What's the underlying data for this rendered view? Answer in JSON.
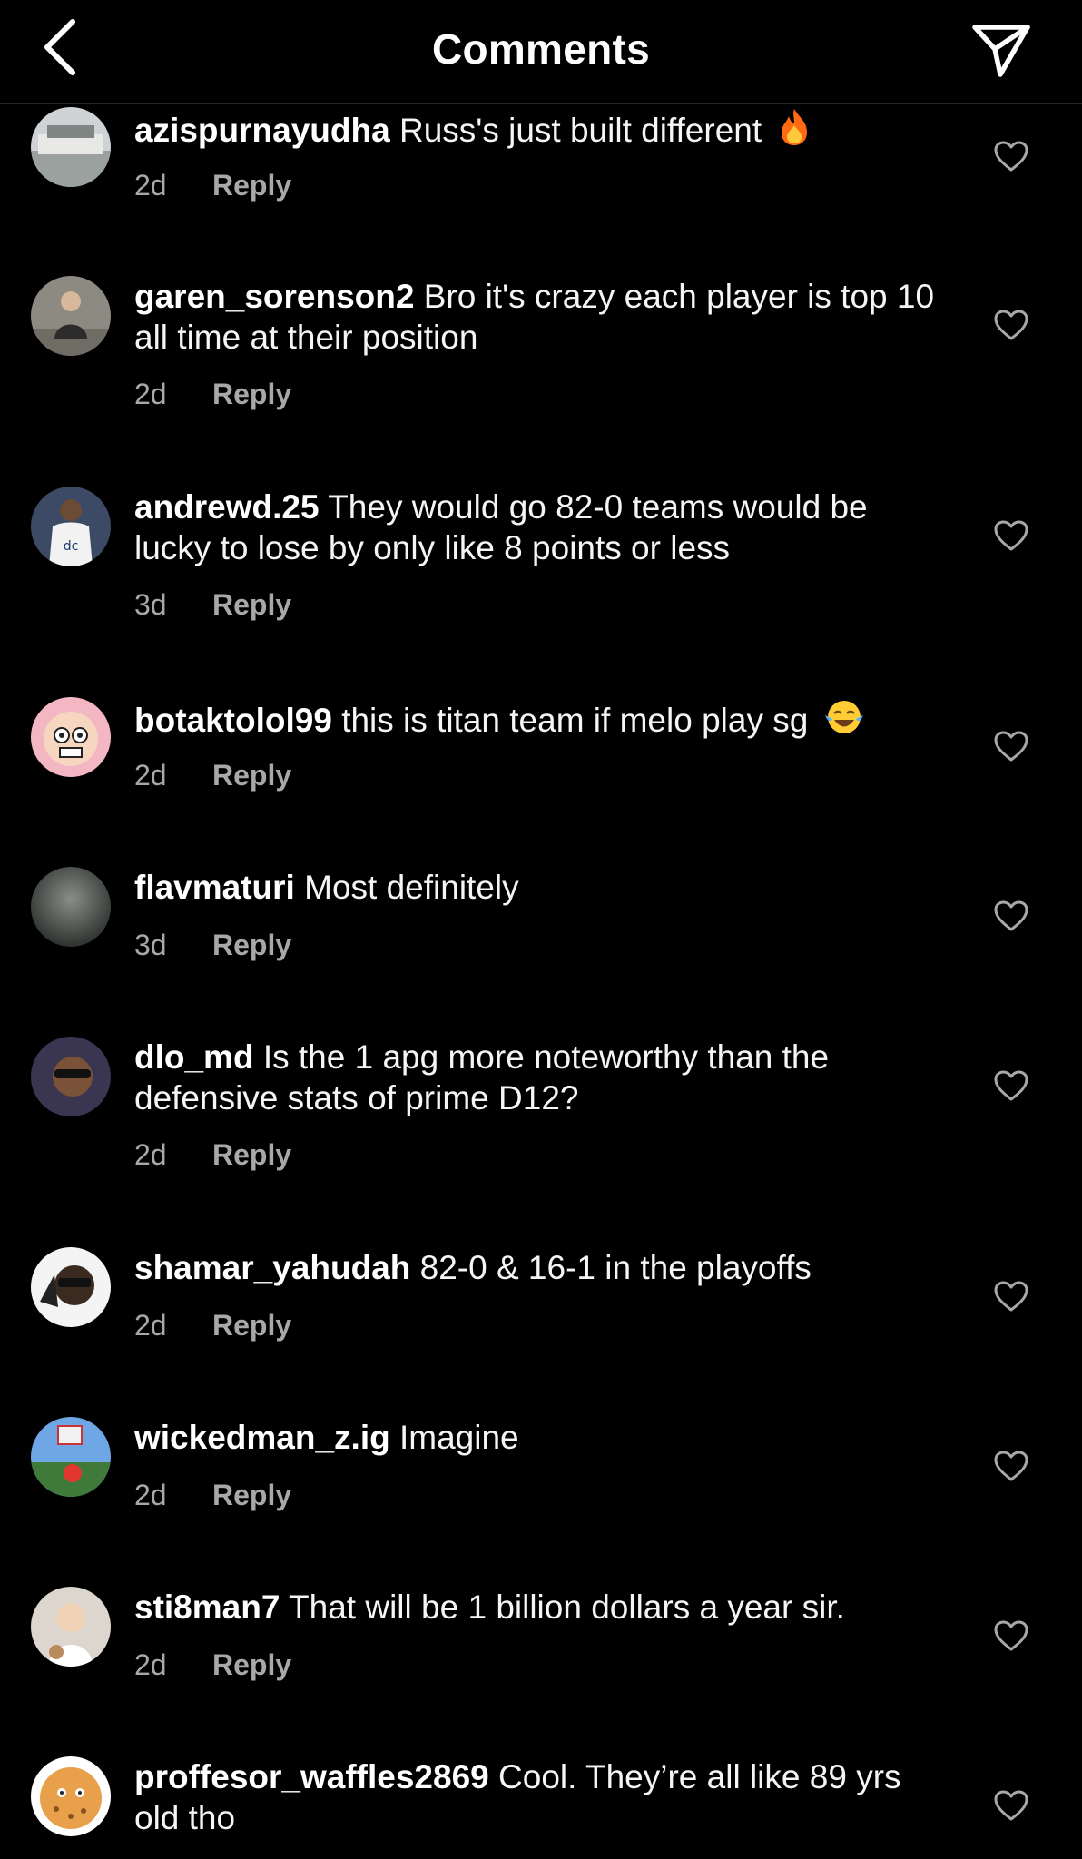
{
  "header": {
    "title": "Comments",
    "back_icon": "chevron-left-icon",
    "share_icon": "paper-plane-icon"
  },
  "colors": {
    "background": "#000000",
    "primary_text": "#ffffff",
    "secondary_text": "#a8a8a8"
  },
  "comments": [
    {
      "username": "azispurnayudha",
      "text": "Russ's just built different",
      "emoji": "fire",
      "time": "2d",
      "reply": "Reply"
    },
    {
      "username": "garen_sorenson2",
      "text": "Bro it's crazy each player is top 10 all time at their position",
      "time": "2d",
      "reply": "Reply"
    },
    {
      "username": "andrewd.25",
      "text": "They would go 82-0 teams would be lucky to lose by only like 8 points or less",
      "time": "3d",
      "reply": "Reply"
    },
    {
      "username": "botaktolol99",
      "text": "this is titan team if melo play sg",
      "emoji": "tears-of-joy",
      "time": "2d",
      "reply": "Reply"
    },
    {
      "username": "flavmaturi",
      "text": "Most definitely",
      "time": "3d",
      "reply": "Reply"
    },
    {
      "username": "dlo_md",
      "text": "Is the 1 apg more noteworthy than the defensive stats of prime D12?",
      "time": "2d",
      "reply": "Reply"
    },
    {
      "username": "shamar_yahudah",
      "text": "82-0 & 16-1 in the playoffs",
      "time": "2d",
      "reply": "Reply"
    },
    {
      "username": "wickedman_z.ig",
      "text": "Imagine",
      "time": "2d",
      "reply": "Reply"
    },
    {
      "username": "sti8man7",
      "text": "That will be 1 billion dollars a year sir.",
      "time": "2d",
      "reply": "Reply"
    },
    {
      "username": "proffesor_waffles2869",
      "text": "Cool. They’re all like 89 yrs old tho"
    }
  ]
}
